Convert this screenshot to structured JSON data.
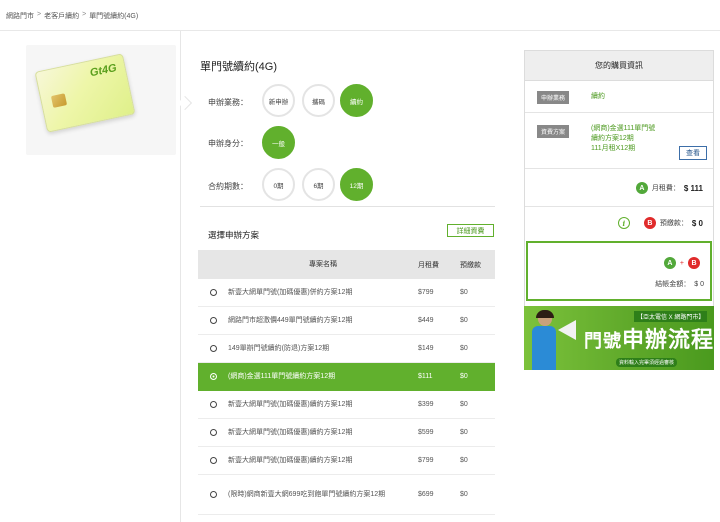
{
  "breadcrumb": [
    "網路門市",
    "老客戶續約",
    "單門號續約(4G)"
  ],
  "product": {
    "logo_text": "Gt4G"
  },
  "form": {
    "title": "單門號續約(4G)",
    "business_label": "申辦業務：",
    "business_options": [
      "新申辦",
      "攜碼",
      "續約"
    ],
    "business_selected": 2,
    "identity_label": "申辦身分：",
    "identity_options": [
      "一般"
    ],
    "identity_selected": 0,
    "period_label": "合約期數：",
    "period_options": [
      "0期",
      "6期",
      "12期"
    ],
    "period_selected": 2
  },
  "plans": {
    "section_title": "選擇申辦方案",
    "detail_button": "詳細資費",
    "headers": {
      "name": "專案名稱",
      "fee": "月租費",
      "prepay": "預繳款"
    },
    "rows": [
      {
        "name": "新壹大網單門號(加碼優惠)併約方案12期",
        "fee": "$799",
        "prepay": "$0",
        "selected": false
      },
      {
        "name": "網路門市超激價449單門號續約方案12期",
        "fee": "$449",
        "prepay": "$0",
        "selected": false
      },
      {
        "name": "149單辦門號續約(防退)方案12期",
        "fee": "$149",
        "prepay": "$0",
        "selected": false
      },
      {
        "name": "(網商)金選111單門號續約方案12期",
        "fee": "$111",
        "prepay": "$0",
        "selected": true
      },
      {
        "name": "新壹大網單門號(加碼優惠)續約方案12期",
        "fee": "$399",
        "prepay": "$0",
        "selected": false
      },
      {
        "name": "新壹大網單門號(加碼優惠)續約方案12期",
        "fee": "$599",
        "prepay": "$0",
        "selected": false
      },
      {
        "name": "新壹大網單門號(加碼優惠)續約方案12期",
        "fee": "$799",
        "prepay": "$0",
        "selected": false
      },
      {
        "name": "(限時)網商新壹大網699吃到飽單門號續約方案12期",
        "fee": "$699",
        "prepay": "$0",
        "selected": false
      }
    ]
  },
  "summary": {
    "title": "您的購買資訊",
    "business_tag": "申辦業務",
    "business_value": "續約",
    "plan_tag": "資費方案",
    "plan_value_lines": [
      "(網商)金選111單門號",
      "續約方案12期",
      "111月租X12期"
    ],
    "view_button": "查看",
    "monthly_label": "月租費：",
    "monthly_value": "$ 111",
    "prepay_label": "預繳款：",
    "prepay_value": "$ 0",
    "total_label": "結帳金額：",
    "total_value": "$ 0",
    "circle_a": "A",
    "circle_b": "B",
    "circle_i": "i",
    "plus": "+"
  },
  "banner": {
    "sub": "【亞太電信 X 網路門市】",
    "big_part1": "門號",
    "big_part2": "申辦流程",
    "note": "資料輸入完畢須經過審核"
  },
  "colors": {
    "accent": "#61b02d",
    "badge_a": "#52a83a",
    "badge_b": "#e02b2b"
  }
}
